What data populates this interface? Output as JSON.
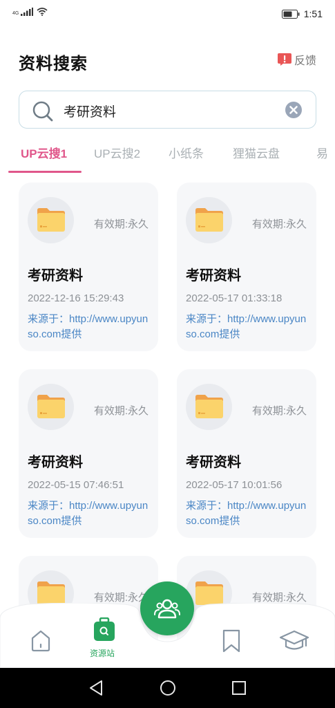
{
  "status_bar": {
    "network": "4G",
    "time": "1:51"
  },
  "header": {
    "title": "资料搜索",
    "feedback_label": "反馈",
    "feedback_icon": "alert-icon"
  },
  "search": {
    "value": "考研资料",
    "search_icon": "search-icon",
    "clear_icon": "clear-icon"
  },
  "tabs": [
    {
      "label": "UP云搜1",
      "active": true
    },
    {
      "label": "UP云搜2",
      "active": false
    },
    {
      "label": "小纸条",
      "active": false
    },
    {
      "label": "狸猫云盘",
      "active": false
    },
    {
      "label": "易",
      "active": false
    }
  ],
  "results": [
    {
      "validity": "有效期:永久",
      "title": "考研资料",
      "date": "2022-12-16 15:29:43",
      "source": "来源于：http://www.upyunso.com提供"
    },
    {
      "validity": "有效期:永久",
      "title": "考研资料",
      "date": "2022-05-17 01:33:18",
      "source": "来源于：http://www.upyunso.com提供"
    },
    {
      "validity": "有效期:永久",
      "title": "考研资料",
      "date": "2022-05-15 07:46:51",
      "source": "来源于：http://www.upyunso.com提供"
    },
    {
      "validity": "有效期:永久",
      "title": "考研资料",
      "date": "2022-05-17 10:01:56",
      "source": "来源于：http://www.upyunso.com提供"
    },
    {
      "validity": "有效期:永久",
      "title": "",
      "date": "",
      "source": ""
    },
    {
      "validity": "有效期:永久",
      "title": "",
      "date": "",
      "source": ""
    }
  ],
  "bottom_nav": {
    "items": [
      {
        "icon": "home-icon",
        "label": ""
      },
      {
        "icon": "resource-bag-icon",
        "label": "资源站"
      },
      {
        "icon": "community-icon",
        "label": ""
      },
      {
        "icon": "bookmark-icon",
        "label": ""
      },
      {
        "icon": "graduation-cap-icon",
        "label": ""
      }
    ]
  },
  "colors": {
    "accent": "#e0568a",
    "green": "#27a55e",
    "link": "#4a86c5",
    "muted": "#8d9196"
  }
}
